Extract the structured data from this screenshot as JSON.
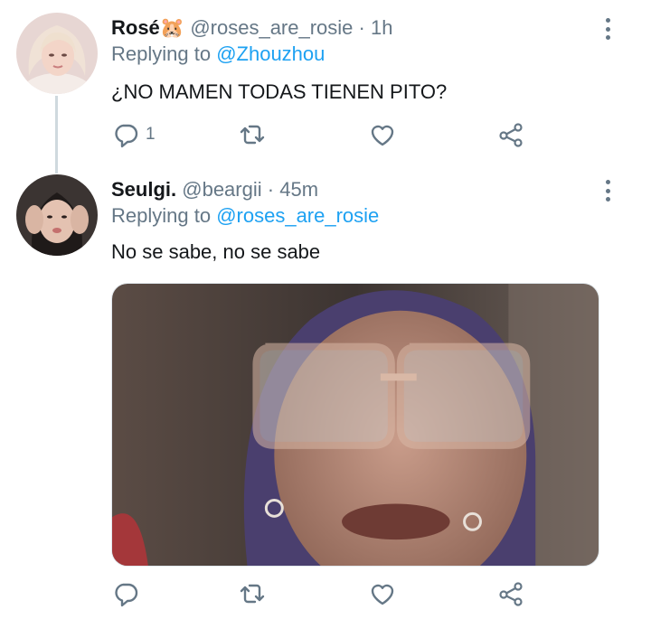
{
  "tweets": [
    {
      "display_name": "Rosé",
      "name_emoji": "🐹",
      "handle": "@roses_are_rosie",
      "separator": "·",
      "time": "1h",
      "replying_prefix": "Replying to",
      "replying_to": "@Zhouzhou",
      "text": "¿NO MAMEN TODAS TIENEN PITO?",
      "reply_count": "1"
    },
    {
      "display_name": "Seulgi.",
      "handle": "@beargii",
      "separator": "·",
      "time": "45m",
      "replying_prefix": "Replying to",
      "replying_to": "@roses_are_rosie",
      "text": "No se sabe, no se sabe",
      "reply_count": ""
    }
  ],
  "icons": {
    "reply": "reply-icon",
    "retweet": "retweet-icon",
    "like": "like-icon",
    "share": "share-icon",
    "more": "more-vertical-icon"
  },
  "colors": {
    "text": "#14171a",
    "secondary": "#657786",
    "link": "#1da1f2",
    "thread_line": "#cfd9de"
  }
}
